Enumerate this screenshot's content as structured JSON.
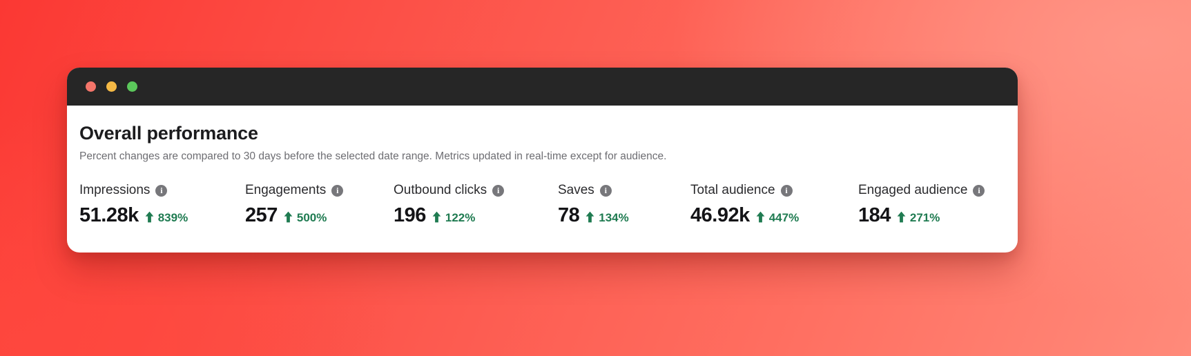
{
  "window": {
    "traffic_lights": [
      {
        "name": "close",
        "color": "#f4756a"
      },
      {
        "name": "minimize",
        "color": "#f5b945"
      },
      {
        "name": "maximize",
        "color": "#5bc75b"
      }
    ]
  },
  "panel": {
    "title": "Overall performance",
    "subtitle": "Percent changes are compared to 30 days before the selected date range. Metrics updated in real-time except for audience.",
    "info_icon_glyph": "i",
    "info_icon_name": "info-icon",
    "arrow_icon_name": "arrow-up-icon",
    "positive_color": "#1f7b51"
  },
  "metrics": [
    {
      "label": "Impressions",
      "value": "51.28k",
      "trend": "up",
      "change": "839%"
    },
    {
      "label": "Engagements",
      "value": "257",
      "trend": "up",
      "change": "500%"
    },
    {
      "label": "Outbound clicks",
      "value": "196",
      "trend": "up",
      "change": "122%"
    },
    {
      "label": "Saves",
      "value": "78",
      "trend": "up",
      "change": "134%"
    },
    {
      "label": "Total audience",
      "value": "46.92k",
      "trend": "up",
      "change": "447%"
    },
    {
      "label": "Engaged audience",
      "value": "184",
      "trend": "up",
      "change": "271%"
    }
  ]
}
